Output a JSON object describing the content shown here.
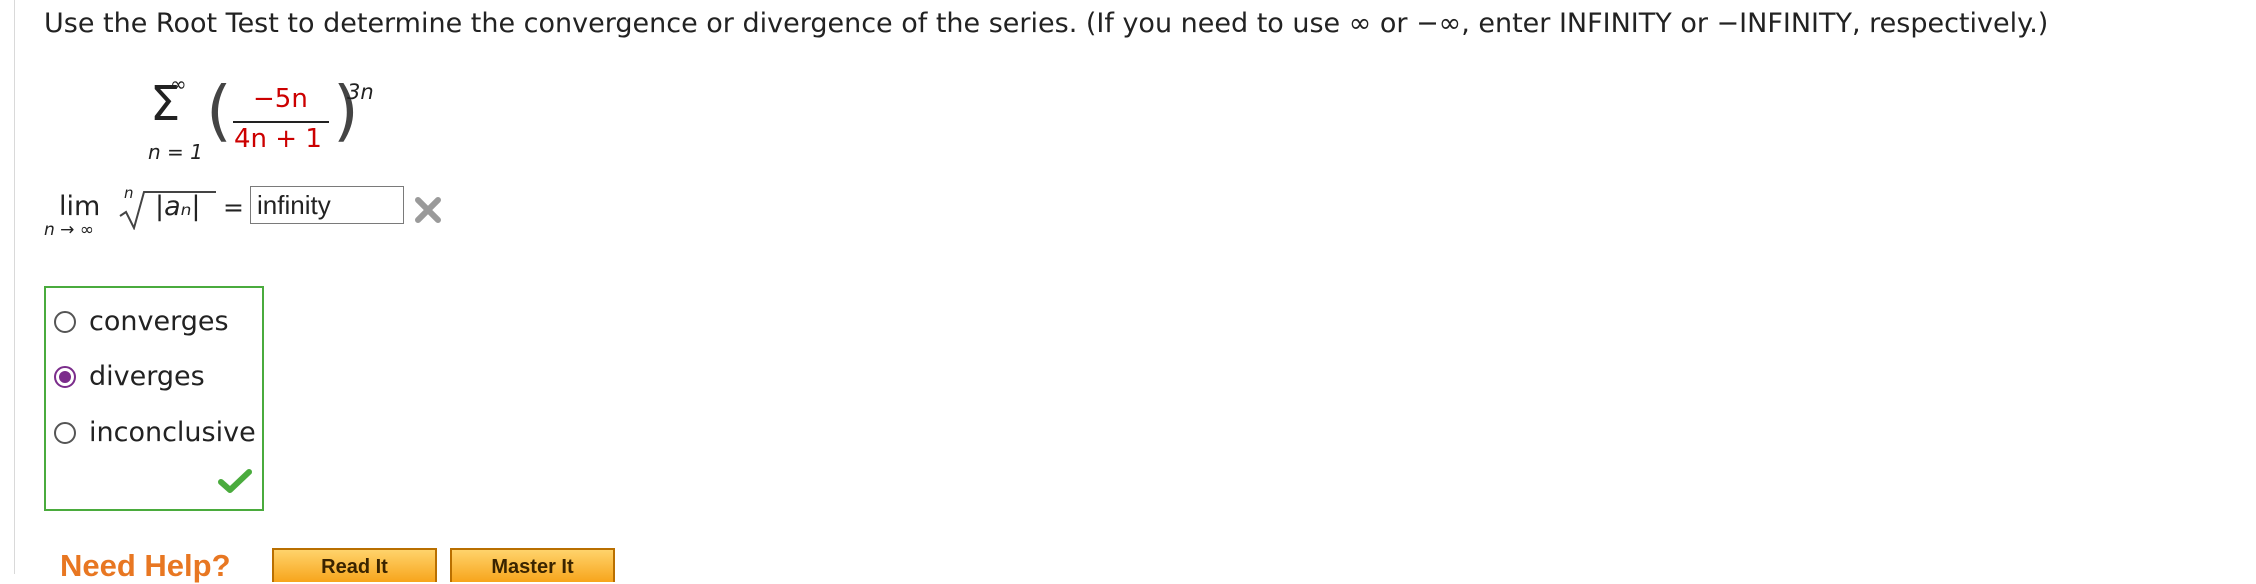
{
  "question": {
    "prefix": "Use the Root Test to determine the convergence or divergence of the series. (If you need to use ",
    "infinity_symbol": "∞",
    "middle": " or ",
    "neg_infinity_symbol": "−∞",
    "suffix": ", enter INFINITY or −INFINITY, respectively.)"
  },
  "series": {
    "upper": "∞",
    "sigma": "Σ",
    "lower": "n = 1",
    "numerator": "−5n",
    "denominator": "4n + 1",
    "exponent": "3n"
  },
  "limit": {
    "lim": "lim",
    "subscript": "n → ∞",
    "root_index": "n",
    "radicand": "|aₙ|",
    "equals": "="
  },
  "answer_input": {
    "value": "infinity",
    "status": "incorrect"
  },
  "choices": [
    {
      "label": "converges",
      "selected": false
    },
    {
      "label": "diverges",
      "selected": true
    },
    {
      "label": "inconclusive",
      "selected": false
    }
  ],
  "choices_status": "correct",
  "help": {
    "label": "Need Help?",
    "read_it": "Read It",
    "master_it": "Master It"
  },
  "colors": {
    "accent_red": "#cc0000",
    "correct_green": "#4aab3d",
    "selected_purple": "#7b2d8b",
    "help_orange": "#e87722"
  }
}
